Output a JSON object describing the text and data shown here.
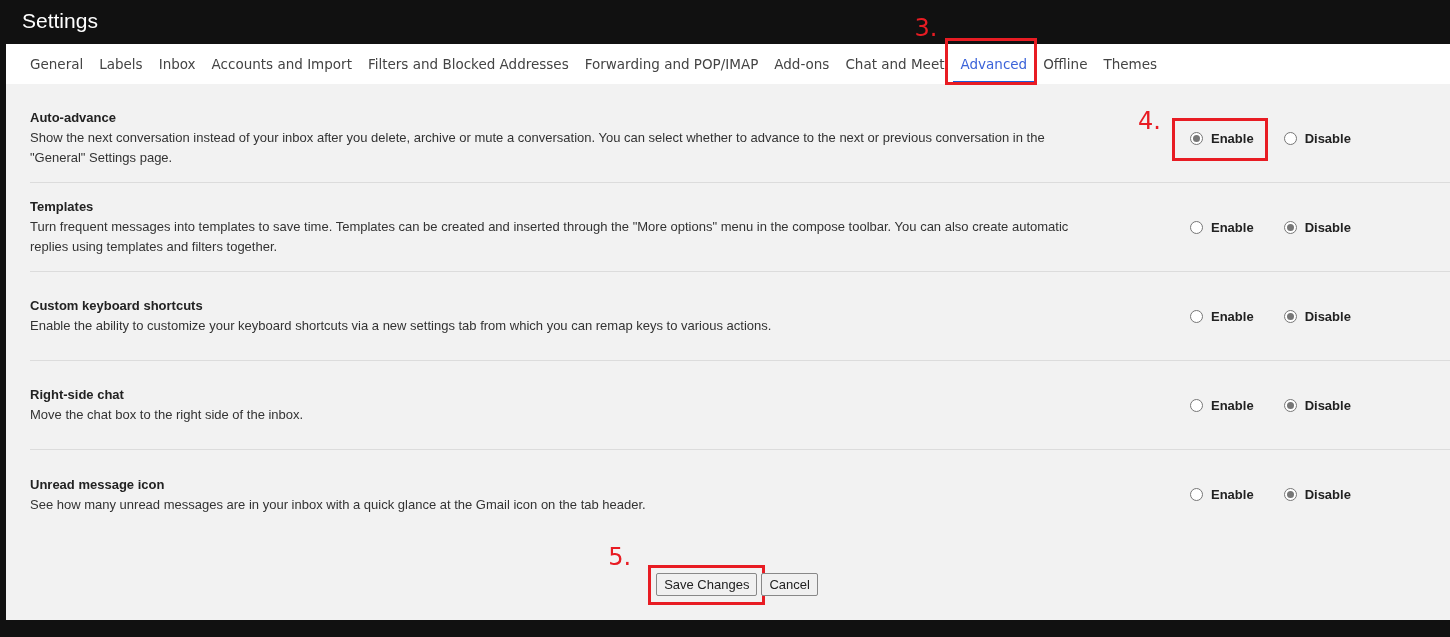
{
  "window": {
    "title": "Settings"
  },
  "tabs": [
    {
      "label": "General",
      "selected": false
    },
    {
      "label": "Labels",
      "selected": false
    },
    {
      "label": "Inbox",
      "selected": false
    },
    {
      "label": "Accounts and Import",
      "selected": false
    },
    {
      "label": "Filters and Blocked Addresses",
      "selected": false
    },
    {
      "label": "Forwarding and POP/IMAP",
      "selected": false
    },
    {
      "label": "Add-ons",
      "selected": false
    },
    {
      "label": "Chat and Meet",
      "selected": false
    },
    {
      "label": "Advanced",
      "selected": true,
      "annotation": "3."
    },
    {
      "label": "Offline",
      "selected": false
    },
    {
      "label": "Themes",
      "selected": false
    }
  ],
  "settings": [
    {
      "title": "Auto-advance",
      "description": "Show the next conversation instead of your inbox after you delete, archive or mute a conversation. You can select whether to advance to the next or previous conversation in the \"General\" Settings page.",
      "options": [
        {
          "label": "Enable",
          "selected": true,
          "annotation": "4."
        },
        {
          "label": "Disable",
          "selected": false
        }
      ]
    },
    {
      "title": "Templates",
      "description": "Turn frequent messages into templates to save time. Templates can be created and inserted through the \"More options\" menu in the compose toolbar. You can also create automatic replies using templates and filters together.",
      "options": [
        {
          "label": "Enable",
          "selected": false
        },
        {
          "label": "Disable",
          "selected": true
        }
      ]
    },
    {
      "title": "Custom keyboard shortcuts",
      "description": "Enable the ability to customize your keyboard shortcuts via a new settings tab from which you can remap keys to various actions.",
      "options": [
        {
          "label": "Enable",
          "selected": false
        },
        {
          "label": "Disable",
          "selected": true
        }
      ]
    },
    {
      "title": "Right-side chat",
      "description": "Move the chat box to the right side of the inbox.",
      "options": [
        {
          "label": "Enable",
          "selected": false
        },
        {
          "label": "Disable",
          "selected": true
        }
      ]
    },
    {
      "title": "Unread message icon",
      "description": "See how many unread messages are in your inbox with a quick glance at the Gmail icon on the tab header.",
      "options": [
        {
          "label": "Enable",
          "selected": false
        },
        {
          "label": "Disable",
          "selected": true
        }
      ]
    }
  ],
  "buttons": [
    {
      "label": "Save Changes",
      "annotation": "5."
    },
    {
      "label": "Cancel"
    }
  ]
}
